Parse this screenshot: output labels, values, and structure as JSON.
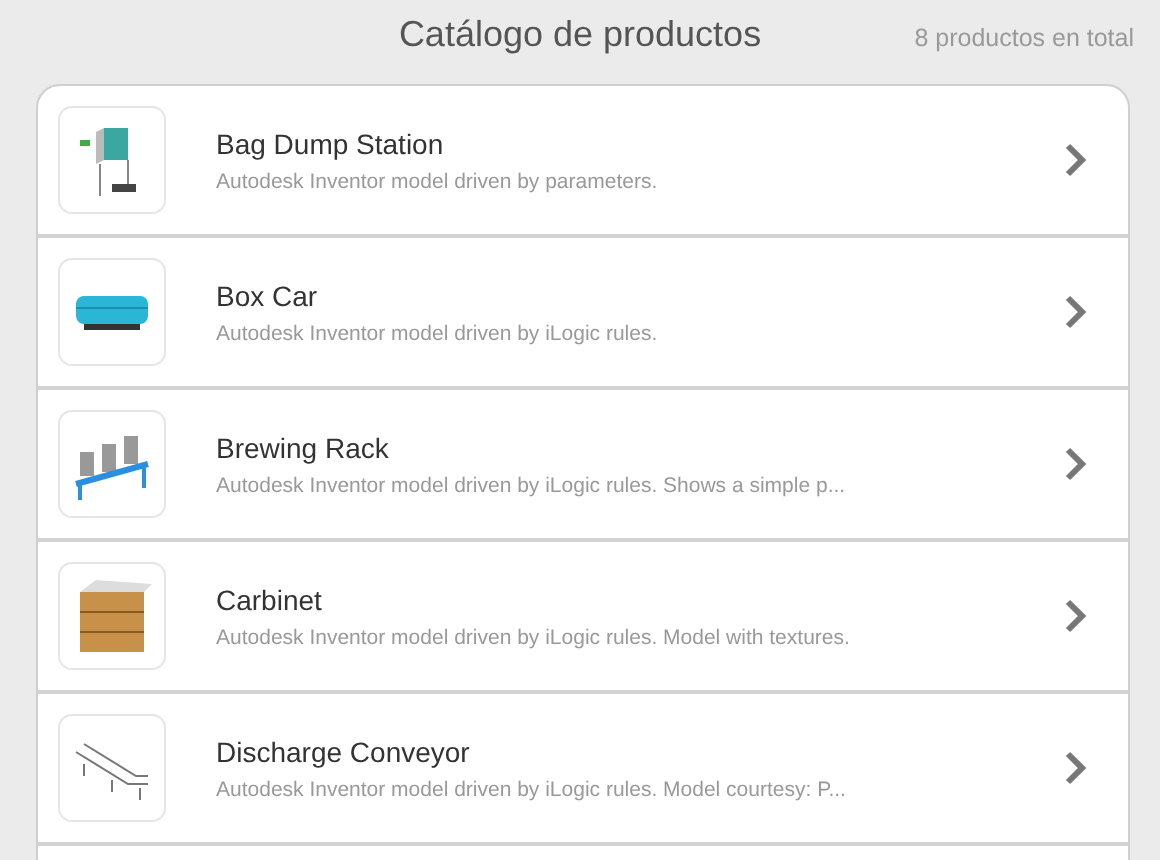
{
  "header": {
    "title": "Catálogo de productos",
    "count": "8 productos en total"
  },
  "products": [
    {
      "kind": "station",
      "name": "Bag Dump Station",
      "description": "Autodesk Inventor model driven by parameters."
    },
    {
      "kind": "car",
      "name": "Box Car",
      "description": "Autodesk Inventor model driven by iLogic rules."
    },
    {
      "kind": "rack",
      "name": "Brewing Rack",
      "description": "Autodesk Inventor model driven by iLogic rules. Shows a simple p..."
    },
    {
      "kind": "cabinet",
      "name": "Carbinet",
      "description": "Autodesk Inventor model driven by iLogic rules. Model with textures."
    },
    {
      "kind": "conveyor",
      "name": "Discharge Conveyor",
      "description": "Autodesk Inventor model driven by iLogic rules. Model courtesy: P..."
    }
  ]
}
